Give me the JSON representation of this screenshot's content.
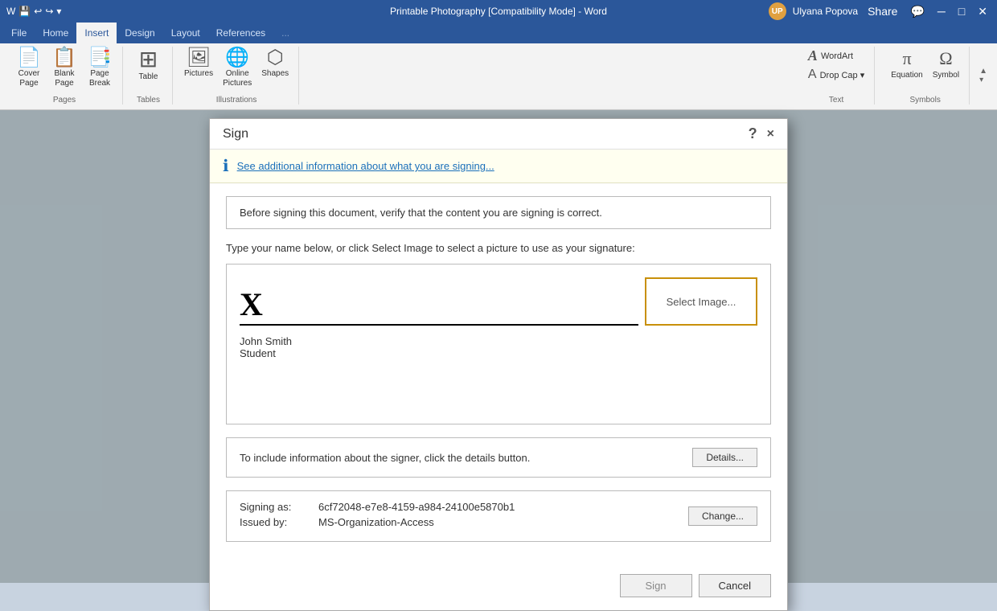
{
  "titleBar": {
    "title": "Printable Photography [Compatibility Mode] - Word",
    "userName": "Ulyana Popova",
    "quickAccess": [
      "save",
      "undo",
      "redo",
      "customize"
    ]
  },
  "ribbon": {
    "tabs": [
      "File",
      "Home",
      "Insert",
      "Design",
      "Layout",
      "References"
    ],
    "activeTab": "Insert",
    "groups": {
      "pages": {
        "label": "Pages",
        "buttons": [
          {
            "icon": "📄",
            "label": "Cover\nPage"
          },
          {
            "icon": "📋",
            "label": "Blank\nPage"
          },
          {
            "icon": "📑",
            "label": "Page\nBreak"
          }
        ]
      },
      "tables": {
        "label": "Tables",
        "buttons": [
          {
            "icon": "⊞",
            "label": "Table"
          }
        ]
      },
      "illustrations": {
        "label": "Illustrations",
        "buttons": [
          {
            "icon": "🖼",
            "label": "Pictures"
          },
          {
            "icon": "🗃",
            "label": "Online\nPictures"
          },
          {
            "icon": "⬡",
            "label": "Shapes"
          }
        ]
      }
    },
    "rightGroups": {
      "text": {
        "label": "Text",
        "items": [
          {
            "icon": "A",
            "label": "WordArt"
          },
          {
            "icon": "T",
            "label": "Drop\nCap"
          }
        ]
      },
      "symbols": {
        "label": "Symbols",
        "items": [
          {
            "icon": "π",
            "label": "Equation"
          },
          {
            "icon": "Ω",
            "label": "Symbol"
          }
        ]
      }
    }
  },
  "dialog": {
    "title": "Sign",
    "helpBtn": "?",
    "closeBtn": "×",
    "infoBanner": {
      "text": "See additional information about what you are signing...",
      "icon": "ℹ"
    },
    "verifyText": "Before signing this document, verify that the content you are signing is correct.",
    "instructions": "Type your name below, or click Select Image to select a picture to use as your signature:",
    "xMark": "X",
    "signatureInput": {
      "value": "",
      "placeholder": ""
    },
    "selectImageBtn": "Select Image...",
    "signerName": "John Smith",
    "signerTitle": "Student",
    "detailsText": "To include information about the signer, click the details button.",
    "detailsBtn": "Details...",
    "signingAs": {
      "label": "Signing as:",
      "value": "6cf72048-e7e8-4159-a984-24100e5870b1",
      "issuedByLabel": "Issued by:",
      "issuedByValue": "MS-Organization-Access"
    },
    "changeBtn": "Change...",
    "signBtn": "Sign",
    "cancelBtn": "Cancel"
  }
}
